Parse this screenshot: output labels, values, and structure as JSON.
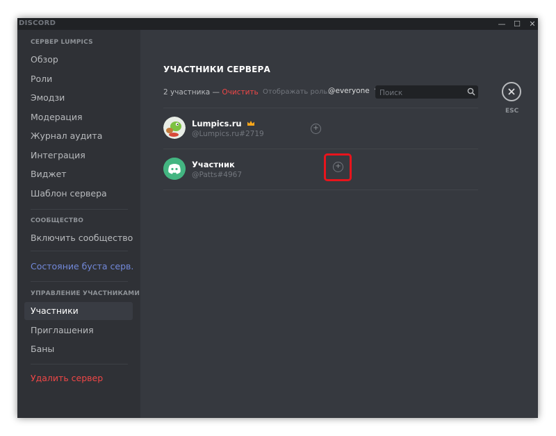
{
  "app": {
    "brand": "DISCORD"
  },
  "window_controls": {
    "minimize": "—",
    "maximize": "☐",
    "close": "✕"
  },
  "sidebar": {
    "server_section": "СЕРВЕР LUMPICS",
    "server_items": [
      {
        "label": "Обзор"
      },
      {
        "label": "Роли"
      },
      {
        "label": "Эмодзи"
      },
      {
        "label": "Модерация"
      },
      {
        "label": "Журнал аудита"
      },
      {
        "label": "Интеграция"
      },
      {
        "label": "Виджет"
      },
      {
        "label": "Шаблон сервера"
      }
    ],
    "community_section": "СООБЩЕСТВО",
    "enable_community": "Включить сообщество",
    "boost_status": "Состояние буста серв...",
    "members_section": "УПРАВЛЕНИЕ УЧАСТНИКАМИ",
    "member_items": [
      {
        "label": "Участники",
        "active": true
      },
      {
        "label": "Приглашения"
      },
      {
        "label": "Баны"
      }
    ],
    "delete_server": "Удалить сервер"
  },
  "main": {
    "title": "УЧАСТНИКИ СЕРВЕРА",
    "count_text": "2 участника — ",
    "clear_label": "Очистить",
    "role_filter_label": "Отображать роль:",
    "role_filter_value": "@everyone",
    "search": {
      "placeholder": "Поиск",
      "value": ""
    },
    "members": [
      {
        "name": "Lumpics.ru",
        "tag": "@Lumpics.ru#2719",
        "owner": true,
        "avatar": "lumpics-avatar"
      },
      {
        "name": "Участник",
        "tag": "@Patts#4967",
        "owner": false,
        "avatar": "discord-default-avatar"
      }
    ],
    "esc_label": "ESC"
  },
  "colors": {
    "accent": "#7289da",
    "danger": "#f04747",
    "highlight": "#e8141c",
    "default_avatar": "#43b581"
  }
}
